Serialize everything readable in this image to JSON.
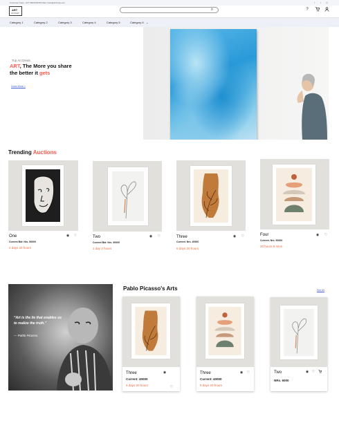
{
  "topbar": {
    "text": "Customer Care: +977 9823454456 Mail: hello@artsnap.com"
  },
  "header": {
    "logo_main": "ART",
    "logo_sub": "ARTSNAP",
    "search_placeholder": ""
  },
  "nav": {
    "items": [
      "Category 1",
      "Category 2",
      "Category 3",
      "Category 4",
      "Category 5",
      "Category 6"
    ]
  },
  "hero": {
    "label": "Top Art Deals",
    "title_accent_1": "ART",
    "title_part_1": ", The More you share",
    "title_part_2": "the better it ",
    "title_accent_2": "gets",
    "learn_more": "Learn More >"
  },
  "trending": {
    "title": "Trending ",
    "title_accent": "Auctions",
    "cards": [
      {
        "title": "One",
        "bid": "Current Bid: Nrs. 50000",
        "time": "2 days 20 hours"
      },
      {
        "title": "Two",
        "bid": "Current Bid: Nrs. 30000",
        "time": "1 day 3 hours"
      },
      {
        "title": "Three",
        "bid": "Current: Nrs. 40000",
        "time": "5 days 20 hours"
      },
      {
        "title": "Four",
        "bid": "Current: Nrs. 50000",
        "time": "20 hours 5 mins"
      }
    ]
  },
  "picasso": {
    "quote": "“Art is the lie that enables us to realize the truth.”",
    "author": "Pablo Picasso",
    "section_title": "Pablo Picasso's Arts",
    "see_all": "See All",
    "cards": [
      {
        "title": "Three",
        "price": "Current: 40000",
        "time": "5 days 20 hours"
      },
      {
        "title": "Three",
        "price": "Current: 40000",
        "time": "5 days 20 hours"
      },
      {
        "title": "Two",
        "price": "NRs. 6000",
        "time": ""
      }
    ]
  },
  "colors": {
    "accent": "#ff5a4e",
    "time": "#f26a3a",
    "link": "#3d5bd8",
    "nav_bg": "#eef0f8"
  },
  "icons": [
    "search-icon",
    "help-icon",
    "cart-icon",
    "user-icon",
    "eye-icon",
    "heart-icon"
  ]
}
